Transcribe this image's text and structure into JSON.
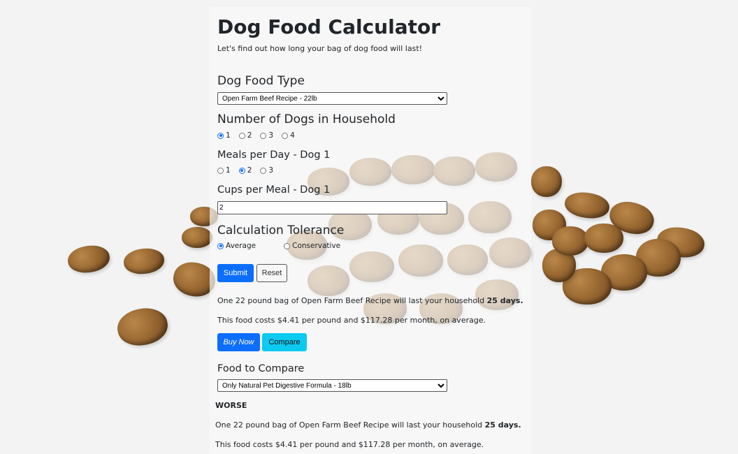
{
  "page": {
    "title": "Dog Food Calculator",
    "subtitle": "Let's find out how long your bag of dog food will last!"
  },
  "food_type": {
    "label": "Dog Food Type",
    "selected": "Open Farm Beef Recipe - 22lb"
  },
  "dogs": {
    "label": "Number of Dogs in Household",
    "options": [
      "1",
      "2",
      "3",
      "4"
    ],
    "selected": "1"
  },
  "meals": {
    "label": "Meals per Day - Dog 1",
    "options": [
      "1",
      "2",
      "3"
    ],
    "selected": "2"
  },
  "cups": {
    "label": "Cups per Meal - Dog 1",
    "value": "2"
  },
  "tolerance": {
    "label": "Calculation Tolerance",
    "options": [
      "Average",
      "Conservative"
    ],
    "selected": "Average"
  },
  "buttons": {
    "submit": "Submit",
    "reset": "Reset",
    "buy_now": "Buy Now",
    "compare": "Compare"
  },
  "result": {
    "line1_prefix": "One 22 pound bag of Open Farm Beef Recipe will last your household ",
    "line1_days": "25 days.",
    "line2": "This food costs $4.41 per pound and $117.28 per month, on average."
  },
  "compare": {
    "label": "Food to Compare",
    "selected": "Only Natural Pet Digestive Formula - 18lb",
    "verdict": "WORSE",
    "line1_prefix": "One 22 pound bag of Open Farm Beef Recipe will last your household ",
    "line1_days": "25 days.",
    "line2": "This food costs $4.41 per pound and $117.28 per month, on average."
  },
  "colors": {
    "primary": "#0d6efd",
    "info": "#0dcaf0",
    "kibble": "#9b6a33"
  }
}
